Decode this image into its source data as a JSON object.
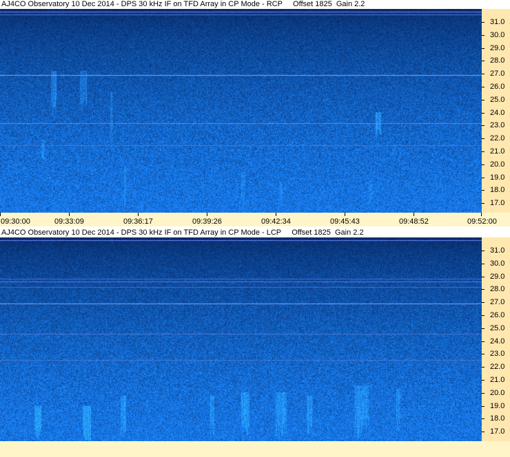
{
  "panels": [
    {
      "id": "rcp",
      "title": "AJ4CO Observatory 10 Dec 2014 - DPS 30 kHz IF on TFD Array in CP Mode - RCP     Offset 1825  Gain 2.2",
      "y_labels": [
        "31.0",
        "30.0",
        "29.0",
        "28.0",
        "27.0",
        "26.0",
        "25.0",
        "24.0",
        "23.0",
        "22.0",
        "21.0",
        "20.0",
        "19.0",
        "18.0",
        "17.0"
      ],
      "x_labels": [
        "09:30:00",
        "09:33:09",
        "09:36:17",
        "09:39:26",
        "09:42:34",
        "09:45:43",
        "09:48:52",
        "09:52:00"
      ]
    },
    {
      "id": "lcp",
      "title": "AJ4CO Observatory 10 Dec 2014 - DPS 30 kHz IF on TFD Array in CP Mode - LCP     Offset 1825  Gain 2.2",
      "y_labels": [
        "31.0",
        "30.0",
        "29.0",
        "28.0",
        "27.0",
        "26.0",
        "25.0",
        "24.0",
        "23.0",
        "22.0",
        "21.0",
        "20.0",
        "19.0",
        "18.0",
        "17.0"
      ]
    }
  ],
  "colors": {
    "axis_bg": "#ffe7b0",
    "time_bg": "#fff5c8",
    "spectrogram_dark": "#0a0f45",
    "spectrogram_light": "#1677f5"
  }
}
